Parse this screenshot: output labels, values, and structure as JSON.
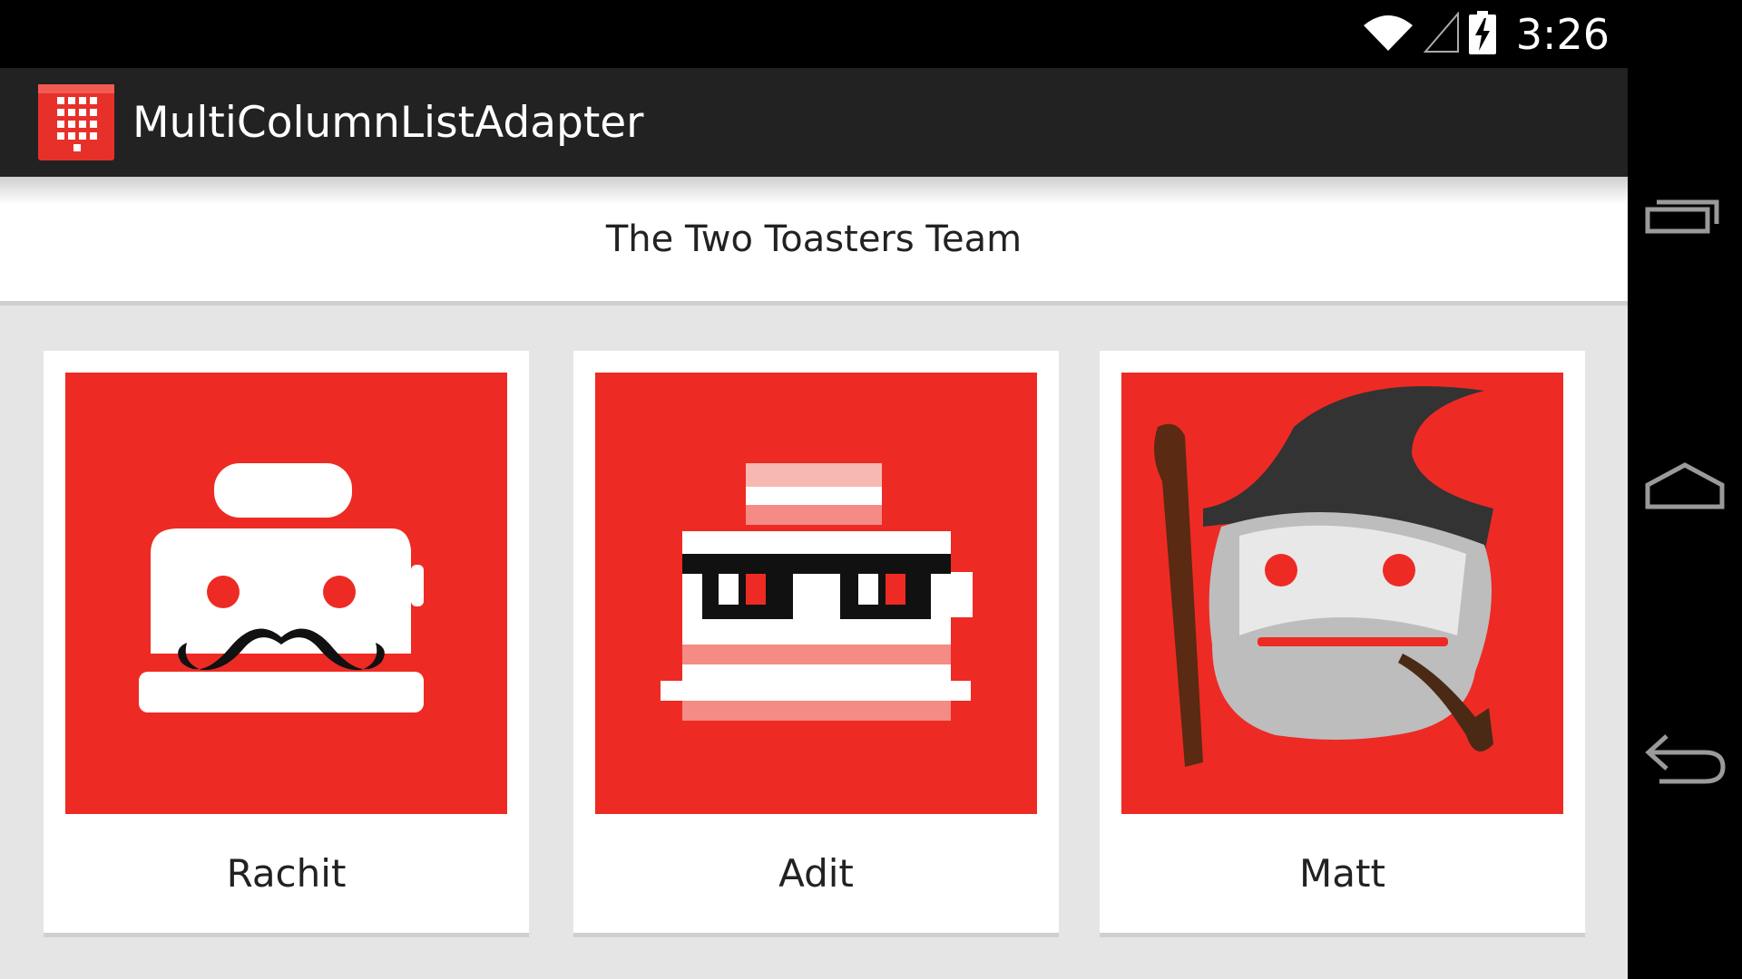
{
  "status_bar": {
    "time": "3:26",
    "icons": [
      "wifi-icon",
      "signal-icon",
      "battery-charging-icon"
    ]
  },
  "action_bar": {
    "app_icon": "app-grid-icon",
    "title": "MultiColumnListAdapter"
  },
  "list": {
    "header": "The Two Toasters Team",
    "items": [
      {
        "name": "Rachit",
        "avatar": "toaster-mustache-avatar"
      },
      {
        "name": "Adit",
        "avatar": "pixel-toaster-glasses-avatar"
      },
      {
        "name": "Matt",
        "avatar": "wizard-toaster-avatar"
      }
    ]
  },
  "nav_bar": {
    "buttons": [
      "recent-apps-icon",
      "home-icon",
      "back-icon"
    ]
  },
  "colors": {
    "accent": "#ee2a24",
    "action_bar": "#222222",
    "background": "#e5e5e5"
  }
}
